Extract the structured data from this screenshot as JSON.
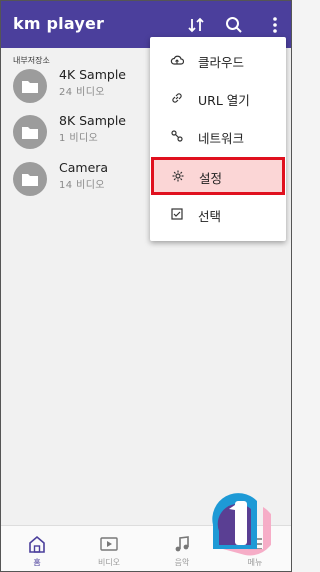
{
  "app": {
    "title": "km player"
  },
  "toolbar": {
    "icons": [
      "sort-icon",
      "search-icon",
      "more-vert-icon"
    ]
  },
  "section": {
    "header": "내부저장소"
  },
  "folders": [
    {
      "name": "4K Sample",
      "count": "24 비디오"
    },
    {
      "name": "8K Sample",
      "count": "1 비디오"
    },
    {
      "name": "Camera",
      "count": "14 비디오"
    }
  ],
  "menu": {
    "items": [
      {
        "label": "클라우드",
        "icon": "cloud-icon"
      },
      {
        "label": "URL 열기",
        "icon": "link-icon"
      },
      {
        "label": "네트워크",
        "icon": "network-icon"
      },
      {
        "label": "설정",
        "icon": "settings-icon",
        "highlighted": true
      },
      {
        "label": "선택",
        "icon": "checkbox-icon"
      }
    ]
  },
  "bottom_nav": {
    "items": [
      {
        "label": "홈",
        "icon": "home-icon",
        "active": true
      },
      {
        "label": "비디오",
        "icon": "video-icon"
      },
      {
        "label": "음악",
        "icon": "music-icon"
      },
      {
        "label": "메뉴",
        "icon": "menu-icon"
      }
    ]
  },
  "colors": {
    "app_bar": "#4b3f9c",
    "highlight_border": "#e0101e",
    "highlight_fill": "#fbd6d6",
    "folder_icon_bg": "#9c9c9c"
  }
}
